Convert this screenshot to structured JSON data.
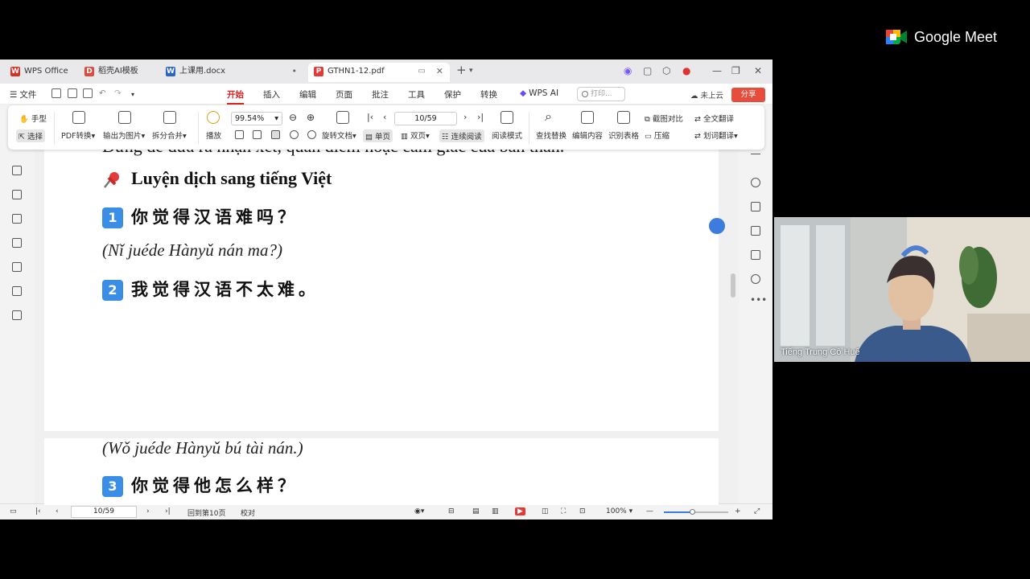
{
  "tabs": [
    {
      "label": "WPS Office",
      "icon": "wps-logo-icon",
      "color": "#d93025"
    },
    {
      "label": "稻壳AI模板",
      "icon": "docer-icon",
      "color": "#e04a3c"
    },
    {
      "label": "上课用.docx",
      "icon": "word-doc-icon",
      "color": "#2b63c9"
    },
    {
      "label": "GTHN1-12.pdf",
      "icon": "pdf-icon",
      "color": "#e53935"
    }
  ],
  "menu": {
    "file": "文件",
    "items": [
      "开始",
      "插入",
      "编辑",
      "页面",
      "批注",
      "工具",
      "保护",
      "转换"
    ],
    "wps_ai": "WPS AI",
    "search_placeholder": "打印...",
    "cloud": "未上云",
    "share": "分享"
  },
  "toolbar": {
    "hand": "手型",
    "select": "选择",
    "pdf_convert": "PDF转换",
    "export_image": "输出为图片",
    "split_merge": "拆分合并",
    "play": "播放",
    "zoom": "99.54%",
    "rotate": "旋转文档",
    "page_input": "10/59",
    "single": "单页",
    "double": "双页",
    "continuous": "连续阅读",
    "read_mode": "阅读模式",
    "find_replace": "查找替换",
    "edit_content": "编辑内容",
    "recognize_table": "识别表格",
    "screenshot_compare": "截图对比",
    "compress": "压缩",
    "full_translate": "全文翻译",
    "word_translate": "划词翻译"
  },
  "document": {
    "cut_line": "Đừng để đưa ra nhận xét, quan điểm hoặc cảm giác của bản thân.",
    "heading": "Luyện dịch sang tiếng Việt",
    "items": [
      {
        "num": "1",
        "zh": "你觉得汉语难吗？",
        "pinyin": "(Nǐ juéde Hànyǔ nán ma?)"
      },
      {
        "num": "2",
        "zh": "我觉得汉语不太难。",
        "pinyin": "(Wǒ juéde Hànyǔ bú tài nán.)"
      },
      {
        "num": "3",
        "zh": "你觉得他怎么样？"
      }
    ]
  },
  "status": {
    "page": "10/59",
    "back": "回到第10页",
    "proof": "校对",
    "zoom": "100%",
    "zoom_level": 0.45
  },
  "meet": {
    "brand": "Google Meet",
    "participant": "Tiếng Trung Cô Huế"
  }
}
